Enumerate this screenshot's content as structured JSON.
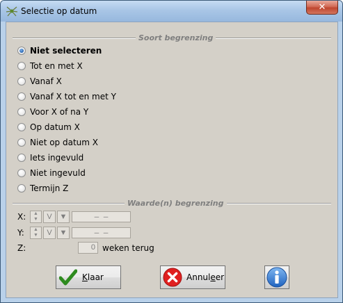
{
  "window": {
    "title": "Selectie op datum",
    "close_glyph": "✕",
    "app_icon": "spider-icon"
  },
  "sort_group": {
    "title": "Soort begrenzing",
    "selected_index": 0,
    "options": [
      {
        "label": "Niet selecteren"
      },
      {
        "label": "Tot en met X"
      },
      {
        "label": "Vanaf X"
      },
      {
        "label": "Vanaf X tot en met Y"
      },
      {
        "label": "Voor X of na Y"
      },
      {
        "label": "Op datum X"
      },
      {
        "label": "Niet op datum X"
      },
      {
        "label": "Iets ingevuld"
      },
      {
        "label": "Niet ingevuld"
      },
      {
        "label": "Termijn Z"
      }
    ]
  },
  "value_group": {
    "title": "Waarde(n) begrenzing",
    "x": {
      "label": "X:",
      "v_label": "V",
      "down_glyph": "▼",
      "date_value": "–   –"
    },
    "y": {
      "label": "Y:",
      "v_label": "V",
      "down_glyph": "▼",
      "date_value": "–   –"
    },
    "z": {
      "label": "Z:",
      "value": "0",
      "unit_label": "weken terug"
    }
  },
  "buttons": {
    "ok": {
      "accel": "K",
      "rest": "laar",
      "icon": "checkmark-icon",
      "color": "#2e8b1f"
    },
    "cancel": {
      "accel": "e",
      "pre": "Annul",
      "rest": "er",
      "icon": "cancel-icon",
      "color": "#e02020"
    },
    "info": {
      "icon": "info-icon",
      "color": "#2f7bd4"
    }
  },
  "colors": {
    "dialog_bg": "#d4d0c8",
    "titlebar": "#a9c6e6",
    "group_title": "#7f7f7f"
  }
}
